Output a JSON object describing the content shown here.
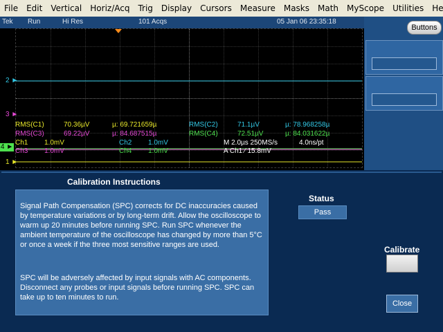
{
  "menu": [
    "File",
    "Edit",
    "Vertical",
    "Horiz/Acq",
    "Trig",
    "Display",
    "Cursors",
    "Measure",
    "Masks",
    "Math",
    "MyScope",
    "Utilities",
    "Help"
  ],
  "status": {
    "brand": "Tek",
    "run_state": "Run",
    "acq_mode": "Hi Res",
    "acqs": "101 Acqs",
    "datetime": "05 Jan 06 23:35:18"
  },
  "side": {
    "buttons_label": "Buttons"
  },
  "channels": {
    "m2": "2",
    "m3": "3",
    "m4": "4",
    "m1": "1"
  },
  "readouts": {
    "rms_c1": "RMS(C1)",
    "rms_c1_val": "70.36µV",
    "rms_c1_mu": "µ: 69.721659µ",
    "rms_c3": "RMS(C3)",
    "rms_c3_val": "69.22µV",
    "rms_c3_mu": "µ: 84.687515µ",
    "rms_c2": "RMS(C2)",
    "rms_c2_val": "71.1µV",
    "rms_c2_mu": "µ: 78.968258µ",
    "rms_c4": "RMS(C4)",
    "rms_c4_val": "72.51µV",
    "rms_c4_mu": "µ: 84.031622µ",
    "ch1": "Ch1",
    "ch1_scale": "1.0mV",
    "ch3": "Ch3",
    "ch3_scale": "1.0mV",
    "ch2": "Ch2",
    "ch2_scale": "1.0mV",
    "ch4": "Ch4",
    "ch4_scale": "1.0mV",
    "timebase": "M 2.0µs 250MS/s",
    "resolution": "4.0ns/pt",
    "trigger": "A  Ch1  ⁄  15.8mV"
  },
  "calibration": {
    "title": "Calibration Instructions",
    "para1": "Signal Path Compensation (SPC) corrects for DC inaccuracies caused by temperature variations or by long-term drift.  Allow the oscilloscope to warm up 20 minutes before running SPC.  Run SPC whenever the ambient temperature of the oscilloscope  has changed by more than 5°C or once a week if the three  most sensitive ranges are used.",
    "para2": "SPC will be adversely affected by input signals with AC components.  Disconnect any probes or input signals before  running SPC.  SPC can take up to ten minutes to run.",
    "status_label": "Status",
    "status_value": "Pass",
    "calibrate_label": "Calibrate",
    "close_label": "Close"
  }
}
